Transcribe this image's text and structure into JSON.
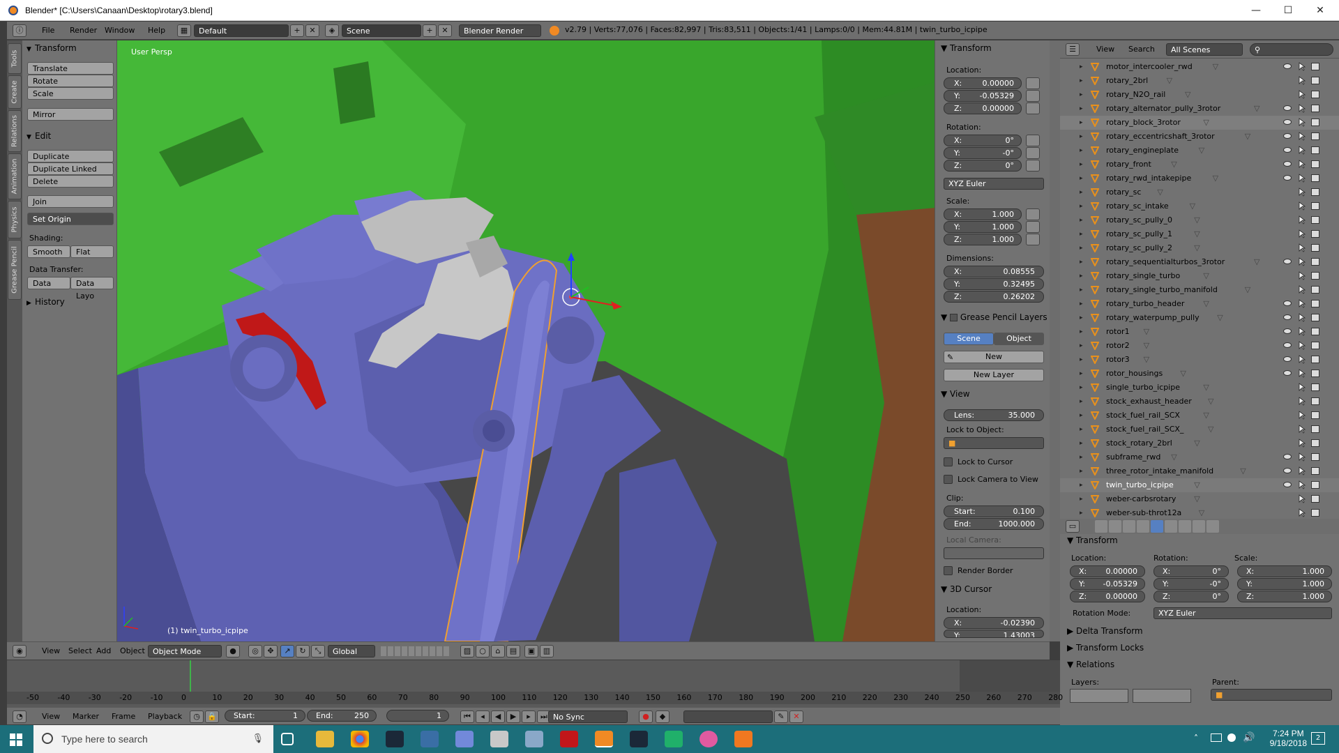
{
  "window": {
    "title": "Blender* [C:\\Users\\Canaan\\Desktop\\rotary3.blend]",
    "minimize": "—",
    "maximize": "☐",
    "close": "✕"
  },
  "info_header": {
    "menus": [
      "File",
      "Render",
      "Window",
      "Help"
    ],
    "screen_layout": "Default",
    "scene": "Scene",
    "render_engine": "Blender Render",
    "stats": "v2.79 | Verts:77,076 | Faces:82,997 | Tris:83,511 | Objects:1/41 | Lamps:0/0 | Mem:44.81M | twin_turbo_icpipe"
  },
  "tool_tabs": [
    "Tools",
    "Create",
    "Relations",
    "Animation",
    "Physics",
    "Grease Pencil"
  ],
  "toolshelf": {
    "transform_header": "Transform",
    "transform_buttons": [
      "Translate",
      "Rotate",
      "Scale",
      "Mirror"
    ],
    "edit_header": "Edit",
    "edit_buttons": [
      "Duplicate",
      "Duplicate Linked",
      "Delete",
      "Join"
    ],
    "set_origin": "Set Origin",
    "shading_label": "Shading:",
    "shading_smooth": "Smooth",
    "shading_flat": "Flat",
    "data_transfer_label": "Data Transfer:",
    "data_btn": "Data",
    "data_layo_btn": "Data Layo",
    "history_header": "History"
  },
  "viewport": {
    "label": "User Persp",
    "active_object": "(1) twin_turbo_icpipe"
  },
  "npanel": {
    "transform_header": "Transform",
    "location_label": "Location:",
    "location": [
      {
        "k": "X:",
        "v": "0.00000"
      },
      {
        "k": "Y:",
        "v": "-0.05329"
      },
      {
        "k": "Z:",
        "v": "0.00000"
      }
    ],
    "rotation_label": "Rotation:",
    "rotation": [
      {
        "k": "X:",
        "v": "0°"
      },
      {
        "k": "Y:",
        "v": "-0°"
      },
      {
        "k": "Z:",
        "v": "0°"
      }
    ],
    "rotation_mode": "XYZ Euler",
    "scale_label": "Scale:",
    "scale": [
      {
        "k": "X:",
        "v": "1.000"
      },
      {
        "k": "Y:",
        "v": "1.000"
      },
      {
        "k": "Z:",
        "v": "1.000"
      }
    ],
    "dimensions_label": "Dimensions:",
    "dimensions": [
      {
        "k": "X:",
        "v": "0.08555"
      },
      {
        "k": "Y:",
        "v": "0.32495"
      },
      {
        "k": "Z:",
        "v": "0.26202"
      }
    ],
    "gp_header": "Grease Pencil Layers",
    "gp_scene": "Scene",
    "gp_object": "Object",
    "gp_new": "New",
    "gp_new_layer": "New Layer",
    "view_header": "View",
    "lens": {
      "k": "Lens:",
      "v": "35.000"
    },
    "lock_to_object": "Lock to Object:",
    "lock_to_cursor": "Lock to Cursor",
    "lock_camera": "Lock Camera to View",
    "clip_label": "Clip:",
    "clip_start": {
      "k": "Start:",
      "v": "0.100"
    },
    "clip_end": {
      "k": "End:",
      "v": "1000.000"
    },
    "local_camera": "Local Camera:",
    "render_border": "Render Border",
    "cursor_header": "3D Cursor",
    "cursor_location_label": "Location:",
    "cursor_x": {
      "k": "X:",
      "v": "-0.02390"
    },
    "cursor_y": {
      "k": "Y:",
      "v": "1.43003"
    }
  },
  "outliner": {
    "view": "View",
    "search": "Search",
    "scenes": "All Scenes",
    "items": [
      {
        "name": "motor_intercooler_rwd",
        "visible": true
      },
      {
        "name": "rotary_2brl",
        "visible": false
      },
      {
        "name": "rotary_N2O_rail",
        "visible": false
      },
      {
        "name": "rotary_alternator_pully_3rotor",
        "visible": true
      },
      {
        "name": "rotary_block_3rotor",
        "visible": true
      },
      {
        "name": "rotary_eccentricshaft_3rotor",
        "visible": true
      },
      {
        "name": "rotary_engineplate",
        "visible": true
      },
      {
        "name": "rotary_front",
        "visible": true
      },
      {
        "name": "rotary_rwd_intakepipe",
        "visible": true
      },
      {
        "name": "rotary_sc",
        "visible": false
      },
      {
        "name": "rotary_sc_intake",
        "visible": false
      },
      {
        "name": "rotary_sc_pully_0",
        "visible": false
      },
      {
        "name": "rotary_sc_pully_1",
        "visible": false
      },
      {
        "name": "rotary_sc_pully_2",
        "visible": false
      },
      {
        "name": "rotary_sequentialturbos_3rotor",
        "visible": true
      },
      {
        "name": "rotary_single_turbo",
        "visible": false
      },
      {
        "name": "rotary_single_turbo_manifold",
        "visible": false
      },
      {
        "name": "rotary_turbo_header",
        "visible": true
      },
      {
        "name": "rotary_waterpump_pully",
        "visible": true
      },
      {
        "name": "rotor1",
        "visible": true
      },
      {
        "name": "rotor2",
        "visible": true
      },
      {
        "name": "rotor3",
        "visible": true
      },
      {
        "name": "rotor_housings",
        "visible": true
      },
      {
        "name": "single_turbo_icpipe",
        "visible": false
      },
      {
        "name": "stock_exhaust_header",
        "visible": false
      },
      {
        "name": "stock_fuel_rail_SCX",
        "visible": false
      },
      {
        "name": "stock_fuel_rail_SCX_",
        "visible": false
      },
      {
        "name": "stock_rotary_2brl",
        "visible": false
      },
      {
        "name": "subframe_rwd",
        "visible": true
      },
      {
        "name": "three_rotor_intake_manifold",
        "visible": true
      },
      {
        "name": "twin_turbo_icpipe",
        "visible": true,
        "selected": true
      },
      {
        "name": "weber-carbsrotary",
        "visible": false
      },
      {
        "name": "weber-sub-throt12a",
        "visible": false
      }
    ]
  },
  "properties": {
    "transform_header": "Transform",
    "location_label": "Location:",
    "rotation_label": "Rotation:",
    "scale_label": "Scale:",
    "loc": [
      {
        "k": "X:",
        "v": "0.00000"
      },
      {
        "k": "Y:",
        "v": "-0.05329"
      },
      {
        "k": "Z:",
        "v": "0.00000"
      }
    ],
    "rot": [
      {
        "k": "X:",
        "v": "0°"
      },
      {
        "k": "Y:",
        "v": "-0°"
      },
      {
        "k": "Z:",
        "v": "0°"
      }
    ],
    "scl": [
      {
        "k": "X:",
        "v": "1.000"
      },
      {
        "k": "Y:",
        "v": "1.000"
      },
      {
        "k": "Z:",
        "v": "1.000"
      }
    ],
    "rotation_mode_label": "Rotation Mode:",
    "rotation_mode": "XYZ Euler",
    "delta": "Delta Transform",
    "locks": "Transform Locks",
    "relations": "Relations",
    "layers_label": "Layers:",
    "parent_label": "Parent:"
  },
  "view_header": {
    "menus": [
      "View",
      "Select",
      "Add",
      "Object"
    ],
    "mode": "Object Mode",
    "orientation": "Global"
  },
  "timeline": {
    "ticks": [
      "-50",
      "-40",
      "-30",
      "-20",
      "-10",
      "0",
      "10",
      "20",
      "30",
      "40",
      "50",
      "60",
      "70",
      "80",
      "90",
      "100",
      "110",
      "120",
      "130",
      "140",
      "150",
      "160",
      "170",
      "180",
      "190",
      "200",
      "210",
      "220",
      "230",
      "240",
      "250",
      "260",
      "270",
      "280"
    ],
    "menus": [
      "View",
      "Marker",
      "Frame",
      "Playback"
    ],
    "start": {
      "k": "Start:",
      "v": "1"
    },
    "end": {
      "k": "End:",
      "v": "250"
    },
    "current": "1",
    "sync": "No Sync"
  },
  "taskbar": {
    "search_placeholder": "Type here to search",
    "time": "7:24 PM",
    "date": "9/18/2018",
    "notifications": "2"
  },
  "colors": {
    "ground": "#39a62c",
    "engine": "#6a6dc1",
    "accent_blue": "#5680c2",
    "taskbar": "#1c6e7a"
  }
}
